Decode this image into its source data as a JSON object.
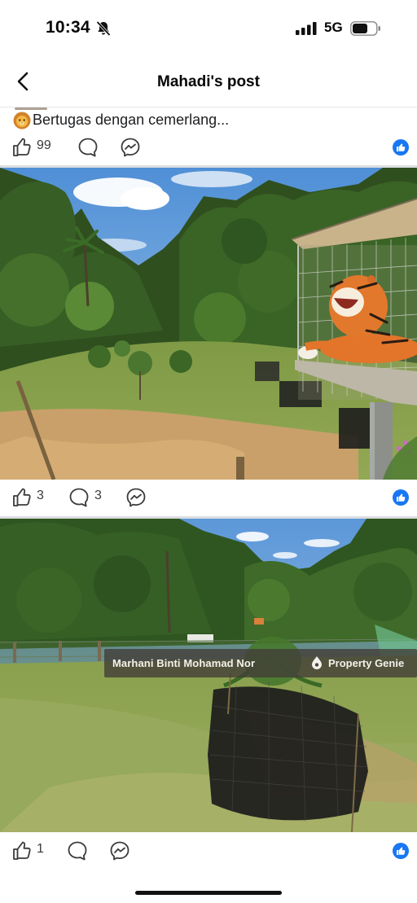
{
  "status_bar": {
    "time": "10:34",
    "network": "5G"
  },
  "header": {
    "title": "Mahadi's post"
  },
  "caption": {
    "text": "Bertugas dengan cemerlang..."
  },
  "posts": [
    {
      "likes": "99",
      "comments": ""
    },
    {
      "likes": "3",
      "comments": "3"
    },
    {
      "likes": "1",
      "comments": ""
    }
  ],
  "watermark": {
    "name": "Marhani Binti Mohamad Nor",
    "brand": "Property Genie"
  },
  "icons": [
    "back-chevron-icon",
    "bell-slash-icon",
    "signal-icon",
    "battery-icon",
    "like-icon",
    "comment-icon",
    "messenger-icon",
    "like-badge-icon",
    "lion-emoji-icon",
    "location-drop-icon"
  ],
  "colors": {
    "facebook_blue": "#1877f2",
    "separator": "#dadde1",
    "text": "#050505"
  }
}
